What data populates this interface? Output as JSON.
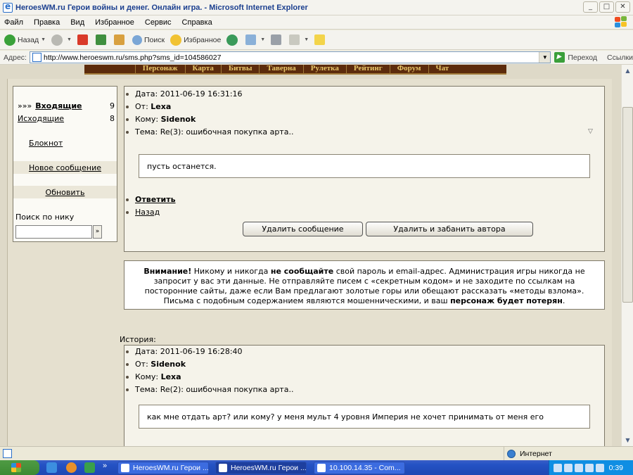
{
  "window": {
    "title": "HeroesWM.ru Герои войны и денег. Онлайн игра. - Microsoft Internet Explorer"
  },
  "menubar": [
    "Файл",
    "Правка",
    "Вид",
    "Избранное",
    "Сервис",
    "Справка"
  ],
  "toolbar": {
    "back": "Назад",
    "search": "Поиск",
    "favorites": "Избранное"
  },
  "address": {
    "label": "Адрес:",
    "url": "http://www.heroeswm.ru/sms.php?sms_id=104586027",
    "go": "Переход",
    "links": "Ссылки"
  },
  "game_menu": [
    "Персонаж",
    "Карта",
    "Битвы",
    "Таверна",
    "Рулетка",
    "Рейтинг",
    "Форум",
    "Чат"
  ],
  "sidebar": {
    "inbox": {
      "arrows": "»»»",
      "label": "Входящие",
      "count": "9"
    },
    "outbox": {
      "label": "Исходящие",
      "count": "8"
    },
    "notepad": "Блокнот",
    "new_message": "Новое сообщение",
    "refresh": "Обновить",
    "search_label": "Поиск по нику",
    "search_button": "»",
    "search_value": ""
  },
  "message": {
    "date_label": "Дата:",
    "date": "2011-06-19 16:31:16",
    "from_label": "От:",
    "from": "Lexa",
    "to_label": "Кому:",
    "to": "Sidenok",
    "subject_label": "Тема:",
    "subject": "Re(3): ошибочная покупка арта..",
    "body": "пусть останется.",
    "reply": "Ответить",
    "back": "Назад",
    "delete_button": "Удалить сообщение",
    "delete_ban_button": "Удалить и забанить автора"
  },
  "warning": {
    "attention": "Внимание!",
    "t1": " Никому и никогда ",
    "never_tell": "не сообщайте",
    "t2": " свой пароль и email-адрес. Администрация игры никогда не запросит у вас эти данные. Не отправляйте писем с «секретным кодом» и не заходите по ссылкам на посторонние сайты, даже если Вам предлагают золотые горы или обещают рассказать «методы взлома». Письма с подобным содержанием являются мошенническими, и ваш ",
    "lost": "персонаж будет потерян",
    "t3": "."
  },
  "history": {
    "label": "История:",
    "date_label": "Дата:",
    "date": "2011-06-19 16:28:40",
    "from_label": "От:",
    "from": "Sidenok",
    "to_label": "Кому:",
    "to": "Lexa",
    "subject_label": "Тема:",
    "subject": "Re(2): ошибочная покупка арта..",
    "body": "как мне отдать арт? или кому? у меня мульт 4 уровня Империя не хочет принимать от меня его"
  },
  "statusbar": {
    "zone": "Интернет"
  },
  "taskbar": {
    "tasks": [
      "HeroesWM.ru Герои ...",
      "HeroesWM.ru Герои ...",
      "10.100.14.35 - Com..."
    ],
    "clock": "0:39"
  }
}
